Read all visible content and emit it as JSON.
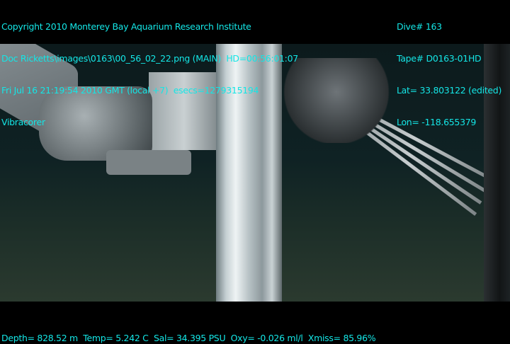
{
  "header_left": [
    "Copyright 2010 Monterey Bay Aquarium Research Institute",
    "Doc Ricketts\\images\\0163\\00_56_02_22.png (MAIN)  HD=00:56:01:07",
    "Fri Jul 16 21:19:54 2010 GMT (local +7)  esecs=1279315194",
    "Vibracorer"
  ],
  "header_right": [
    "Dive# 163",
    "Tape# D0163-01HD",
    "Lat= 33.803122 (edited)",
    "Lon= -118.655379"
  ],
  "footer": "Depth= 828.52 m  Temp= 5.242 C  Sal= 34.395 PSU  Oxy= -0.026 ml/l  Xmiss= 85.96%",
  "overlay_color": "#14e6e6"
}
